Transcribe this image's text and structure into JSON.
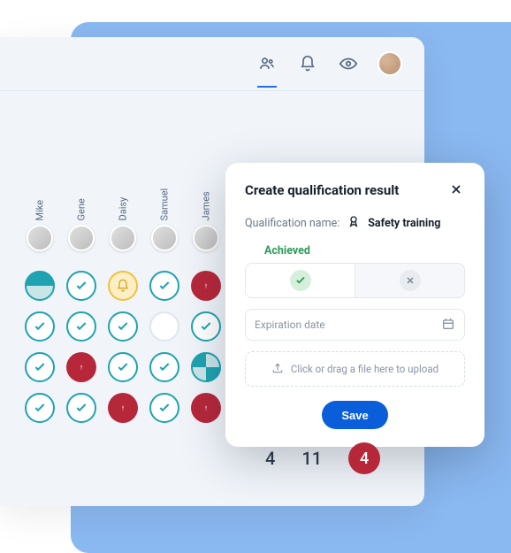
{
  "people": [
    {
      "name": "Mike"
    },
    {
      "name": "Gene"
    },
    {
      "name": "Daisy"
    },
    {
      "name": "Samuel"
    },
    {
      "name": "James"
    }
  ],
  "grid": [
    [
      "pie",
      "check",
      "bell",
      "check",
      "alert"
    ],
    [
      "check",
      "check",
      "check",
      "empty",
      "check"
    ],
    [
      "check",
      "alert",
      "check",
      "check",
      "pie2"
    ],
    [
      "check",
      "check",
      "alert",
      "check",
      "alert"
    ]
  ],
  "modal": {
    "title": "Create qualification result",
    "qual_label": "Qualification name:",
    "qual_name": "Safety training",
    "achieved_tab": "Achieved",
    "date_placeholder": "Expiration date",
    "upload_text": "Click or drag a file here to upload",
    "save_label": "Save"
  },
  "counts": {
    "a": "4",
    "b": "11",
    "c": "4"
  },
  "icons": {
    "contacts": "contacts-icon",
    "bell": "bell-icon",
    "eye": "eye-icon"
  }
}
